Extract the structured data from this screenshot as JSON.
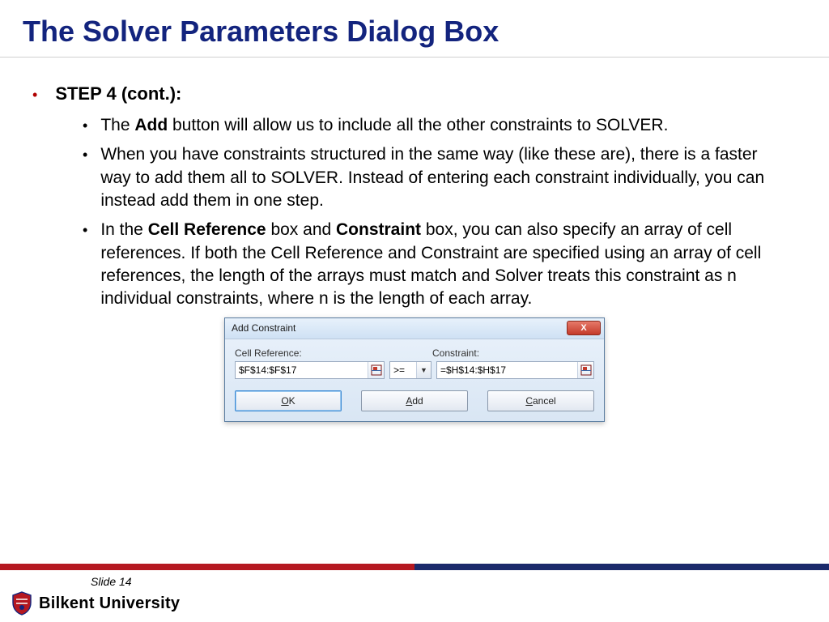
{
  "title": "The Solver Parameters Dialog Box",
  "step_label": "STEP 4 (cont.):",
  "bullets": {
    "b1_pre": "The ",
    "b1_bold": "Add",
    "b1_post": " button will allow us to include all the other constraints to SOLVER.",
    "b2": "When you have constraints structured in the same way (like these are), there is a faster way to add them all to SOLVER. Instead of entering each constraint individually, you can instead add them in one step.",
    "b3_pre": "In the ",
    "b3_bold1": "Cell Reference",
    "b3_mid1": " box and ",
    "b3_bold2": "Constraint",
    "b3_post": " box, you can also specify an array of cell references. If both the Cell Reference and Constraint are specified using an array of cell references, the length of the arrays must match and Solver treats this constraint as n individual constraints, where n is the length of each array."
  },
  "dialog": {
    "title": "Add Constraint",
    "close": "X",
    "label_cellref": "Cell Reference:",
    "label_constraint": "Constraint:",
    "cellref_value": "$F$14:$F$17",
    "operator": ">=",
    "constraint_value": "=$H$14:$H$17",
    "ok_u": "O",
    "ok_rest": "K",
    "add_u": "A",
    "add_rest": "dd",
    "cancel_u": "C",
    "cancel_rest": "ancel"
  },
  "footer": {
    "slide": "Slide 14",
    "university": "Bilkent University"
  }
}
